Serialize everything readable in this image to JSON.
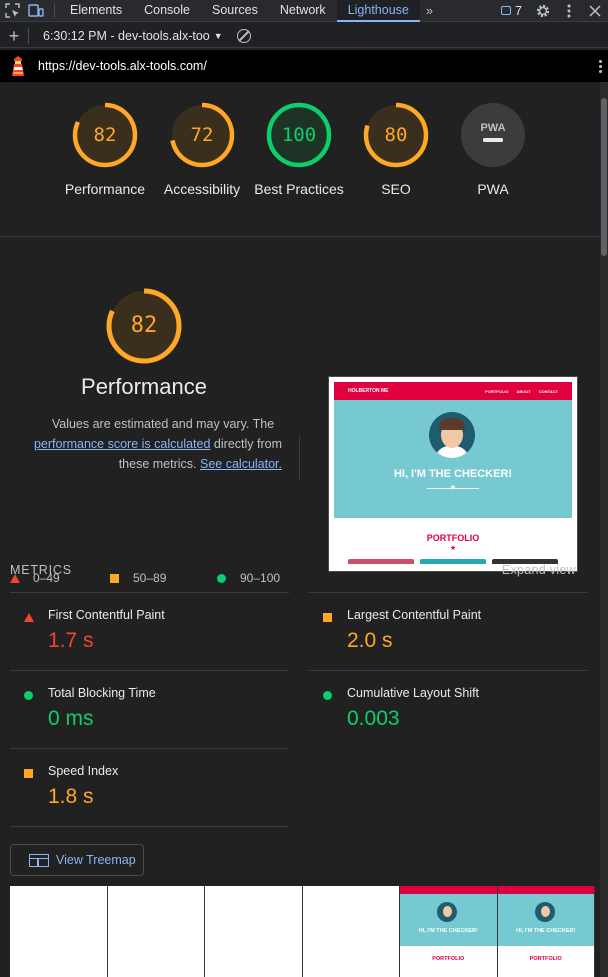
{
  "devtools": {
    "tabs": [
      "Elements",
      "Console",
      "Sources",
      "Network",
      "Lighthouse"
    ],
    "active_tab": "Lighthouse",
    "issues_count": "7"
  },
  "lighthouse": {
    "report_label": "6:30:12 PM - dev-tools.alx-too",
    "url": "https://dev-tools.alx-tools.com/"
  },
  "gauges": [
    {
      "label": "Performance",
      "score": "82",
      "fraction": 0.82,
      "color": "#ffa726"
    },
    {
      "label": "Accessibility",
      "score": "72",
      "fraction": 0.72,
      "color": "#ffa726"
    },
    {
      "label": "Best Practices",
      "score": "100",
      "fraction": 1.0,
      "color": "#0cce6b"
    },
    {
      "label": "SEO",
      "score": "80",
      "fraction": 0.8,
      "color": "#ffa726"
    },
    {
      "label": "PWA",
      "badge": "PWA",
      "color": "#9aa0a6"
    }
  ],
  "performance": {
    "score": "82",
    "fraction": 0.82,
    "title": "Performance",
    "desc_text_1": "Values are estimated and may vary. The",
    "desc_link_1": "performance score is calculated",
    "desc_text_2": "directly from these metrics.",
    "desc_link_2": "See calculator.",
    "legend": [
      {
        "range": "0–49",
        "color": "#f44336"
      },
      {
        "range": "50–89",
        "color": "#ffa726"
      },
      {
        "range": "90–100",
        "color": "#0cce6b"
      }
    ]
  },
  "preview": {
    "site_name": "HOLBERTON ME",
    "nav_links": [
      "PORTFOLIO",
      "ABOUT",
      "CONTACT"
    ],
    "hero_text": "HI, I'M THE CHECKER!",
    "section_title": "PORTFOLIO"
  },
  "metrics": {
    "header": "METRICS",
    "expand_label": "Expand view",
    "items": [
      {
        "name": "First Contentful Paint",
        "value": "1.7 s",
        "rating": "fail"
      },
      {
        "name": "Largest Contentful Paint",
        "value": "2.0 s",
        "rating": "average"
      },
      {
        "name": "Total Blocking Time",
        "value": "0 ms",
        "rating": "pass"
      },
      {
        "name": "Cumulative Layout Shift",
        "value": "0.003",
        "rating": "pass"
      },
      {
        "name": "Speed Index",
        "value": "1.8 s",
        "rating": "average"
      }
    ]
  },
  "treemap_label": "View Treemap",
  "filmstrip": {
    "frames_blank": 4,
    "frames_loaded": 2,
    "frame_hero_text": "HI, I'M THE CHECKER!",
    "frame_section_text": "PORTFOLIO"
  },
  "colors": {
    "accent": "#8ab4f8",
    "pass": "#0cce6b",
    "average": "#ffa726",
    "fail": "#f44336",
    "brand_red": "#e0003f",
    "hero_teal": "#76c9d0"
  }
}
